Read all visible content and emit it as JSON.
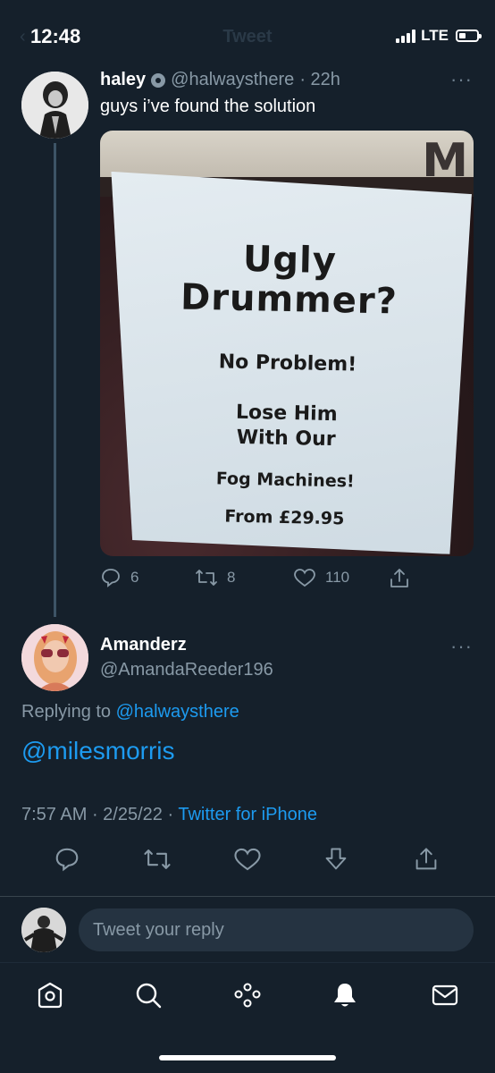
{
  "status": {
    "time": "12:48",
    "network": "LTE"
  },
  "header": {
    "back": "‹",
    "title": "Tweet"
  },
  "tweet1": {
    "name": "haley",
    "handle": "@halwaysthere",
    "time": "· 22h",
    "text": "guys i’ve found the solution",
    "image_text": {
      "letter": "M",
      "line1": "Ugly",
      "line2": "Drummer?",
      "line3": "No Problem!",
      "line4": "Lose Him",
      "line5": "With Our",
      "line6": "Fog Machines!",
      "line7": "From £29.95"
    },
    "replies": "6",
    "retweets": "8",
    "likes": "110"
  },
  "tweet2": {
    "name": "Amanderz",
    "handle": "@AmandaReeder196",
    "replying_prefix": "Replying to",
    "replying_handle": "@halwaysthere",
    "text": "@milesmorris",
    "time": "7:57 AM",
    "date": "· 2/25/22 ·",
    "source": "Twitter for iPhone"
  },
  "reply": {
    "placeholder": "Tweet your reply"
  },
  "colors": {
    "background": "#15202b",
    "accent": "#1d9bf0",
    "muted": "#8899a6"
  }
}
